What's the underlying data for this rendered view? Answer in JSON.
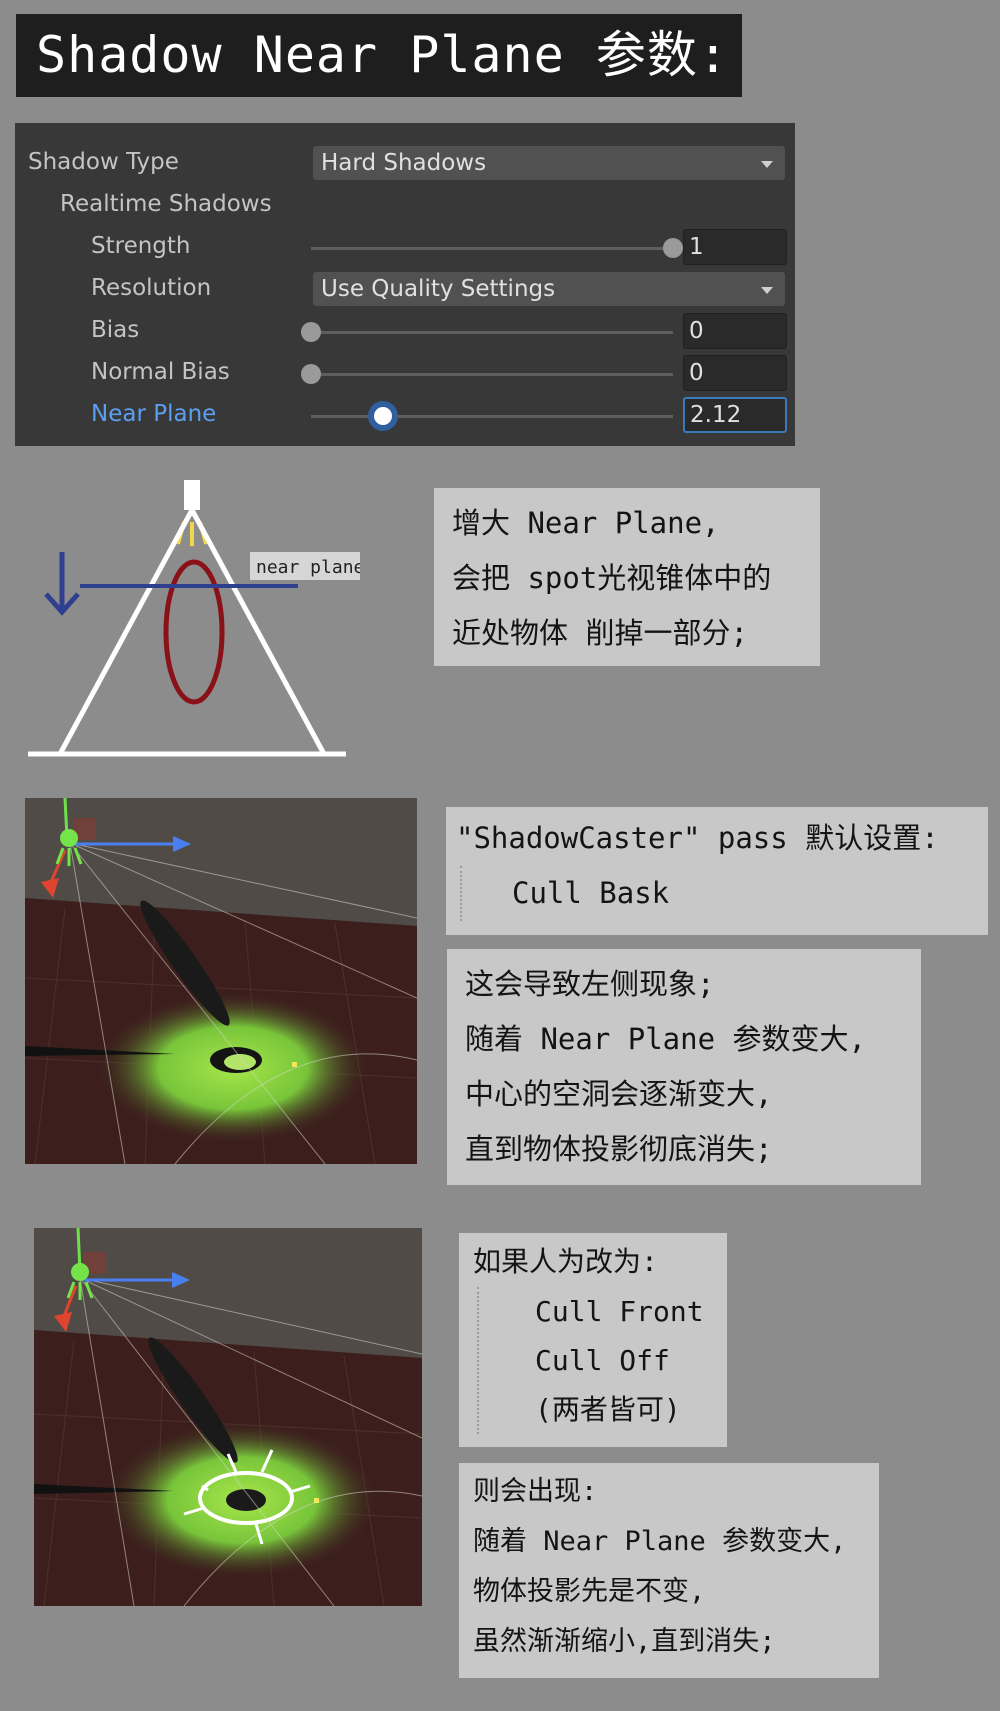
{
  "title": "Shadow Near Plane 参数:",
  "inspector": {
    "shadow_type_label": "Shadow Type",
    "shadow_type_value": "Hard Shadows",
    "realtime_label": "Realtime Shadows",
    "strength_label": "Strength",
    "strength_value": "1",
    "strength_fraction": 1.0,
    "resolution_label": "Resolution",
    "resolution_value": "Use Quality Settings",
    "bias_label": "Bias",
    "bias_value": "0",
    "bias_fraction": 0.0,
    "normal_bias_label": "Normal Bias",
    "normal_bias_value": "0",
    "normal_bias_fraction": 0.0,
    "near_plane_label": "Near Plane",
    "near_plane_value": "2.12",
    "near_plane_fraction": 0.2
  },
  "diagram": {
    "near_plane_tag": "near plane"
  },
  "note1": {
    "lines": [
      "增大 Near Plane,",
      "会把 spot光视锥体中的",
      "近处物体 削掉一部分;"
    ]
  },
  "note2": {
    "line1": "\"ShadowCaster\" pass 默认设置:",
    "line2": "Cull Bask"
  },
  "note3": {
    "lines": [
      "这会导致左侧现象;",
      "随着 Near Plane 参数变大,",
      "中心的空洞会逐渐变大,",
      "直到物体投影彻底消失;"
    ]
  },
  "note4": {
    "line1": "如果人为改为:",
    "lines": [
      "Cull Front",
      "Cull Off",
      "(两者皆可)"
    ]
  },
  "note5": {
    "lines": [
      "则会出现:",
      "随着 Near Plane 参数变大,",
      "物体投影先是不变,",
      "虽然渐渐缩小,直到消失;"
    ]
  },
  "colors": {
    "accent_blue": "#5aa0f0",
    "panel_bg": "#383838",
    "page_bg": "#8c8c8c"
  }
}
